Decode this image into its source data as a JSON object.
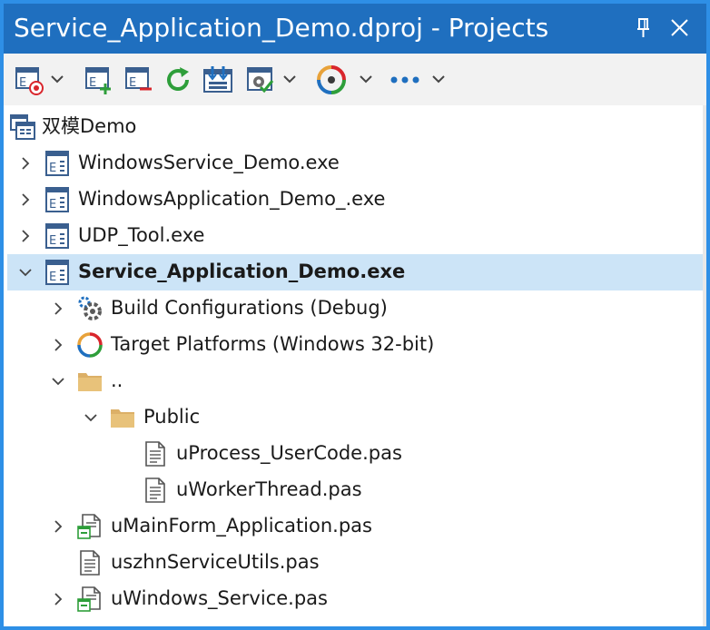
{
  "window": {
    "title": "Service_Application_Demo.dproj - Projects",
    "title_bg": "#1f6fbf",
    "border_color": "#2e8fe6",
    "pin_icon": "pin-icon",
    "close_icon": "close-icon"
  },
  "toolbar": {
    "items": [
      {
        "name": "active-project-icon",
        "dropdown": true
      },
      {
        "name": "add-file-icon",
        "dropdown": false
      },
      {
        "name": "remove-file-icon",
        "dropdown": false
      },
      {
        "name": "sync-icon",
        "dropdown": false
      },
      {
        "name": "build-icon",
        "dropdown": false
      },
      {
        "name": "options-icon",
        "dropdown": true
      },
      {
        "name": "target-platform-icon",
        "dropdown": true
      },
      {
        "name": "more-icon",
        "dropdown": true
      }
    ]
  },
  "tree": {
    "selected_color": "#cce4f7",
    "root": {
      "label": "双模Demo",
      "icon": "project-group-icon"
    },
    "items": [
      {
        "label": "WindowsService_Demo.exe",
        "icon": "project-icon",
        "expander": "collapsed"
      },
      {
        "label": "WindowsApplication_Demo_.exe",
        "icon": "project-icon",
        "expander": "collapsed"
      },
      {
        "label": "UDP_Tool.exe",
        "icon": "project-icon",
        "expander": "collapsed"
      },
      {
        "label": "Service_Application_Demo.exe",
        "icon": "project-icon",
        "expander": "expanded"
      },
      {
        "label": "Build Configurations (Debug)",
        "icon": "gears-icon",
        "expander": "collapsed"
      },
      {
        "label": "Target Platforms (Windows 32-bit)",
        "icon": "target-platforms-icon",
        "expander": "collapsed"
      },
      {
        "label": "..",
        "icon": "folder-icon",
        "expander": "expanded"
      },
      {
        "label": "Public",
        "icon": "folder-icon",
        "expander": "expanded"
      },
      {
        "label": "uProcess_UserCode.pas",
        "icon": "file-icon",
        "expander": "none"
      },
      {
        "label": "uWorkerThread.pas",
        "icon": "file-icon",
        "expander": "none"
      },
      {
        "label": "uMainForm_Application.pas",
        "icon": "form-file-icon",
        "expander": "collapsed"
      },
      {
        "label": "uszhnServiceUtils.pas",
        "icon": "file-icon",
        "expander": "none"
      },
      {
        "label": "uWindows_Service.pas",
        "icon": "form-file-icon",
        "expander": "collapsed"
      }
    ]
  }
}
